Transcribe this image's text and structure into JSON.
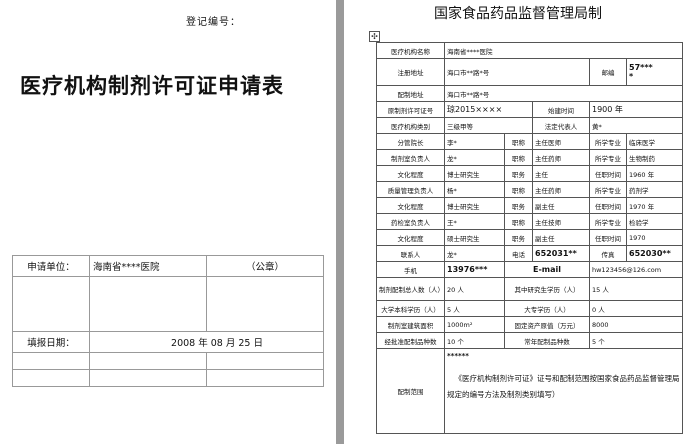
{
  "left": {
    "registration": "登记编号：",
    "title": "医疗机构制剂许可证申请表",
    "applicant_label": "申请单位：",
    "applicant_value": "海南省****医院",
    "seal": "（公章）",
    "date_label": "填报日期：",
    "date_value": "2008 年 08 月  25 日"
  },
  "right": {
    "title": "国家食品药品监督管理局制",
    "handle": "✣",
    "org_name_label": "医疗机构名称",
    "org_name": "海南省****医院",
    "reg_addr_label": "注册地址",
    "reg_addr": "海口市**路*号",
    "zip_label": "邮编",
    "zip": "57***",
    "zip2": "*",
    "prep_addr_label": "配制地址",
    "prep_addr": "海口市**路*号",
    "orig_no_label": "原制剂许可证号",
    "orig_no": "琼2015××××",
    "est_label": "始建时间",
    "est": "1900 年",
    "category_label": "医疗机构类别",
    "category": "三级甲等",
    "legal_label": "法定代表人",
    "legal": "黄*",
    "r1": [
      "分管院长",
      "李*",
      "职称",
      "主任医师",
      "所学专业",
      "临床医学"
    ],
    "r2": [
      "制剂室负责人",
      "龙*",
      "职称",
      "主任药师",
      "所学专业",
      "生物制药"
    ],
    "r3": [
      "文化程度",
      "博士研究生",
      "职务",
      "主任",
      "任职时间",
      "1960 年"
    ],
    "r4": [
      "质量管理负责人",
      "杨*",
      "职称",
      "主任药师",
      "所学专业",
      "药剂学"
    ],
    "r5": [
      "文化程度",
      "博士研究生",
      "职务",
      "副主任",
      "任职时间",
      "1970 年"
    ],
    "r6": [
      "药检室负责人",
      "王*",
      "职称",
      "主任技师",
      "所学专业",
      "检验学"
    ],
    "r7": [
      "文化程度",
      "硕士研究生",
      "职务",
      "副主任",
      "任职时间",
      "1970"
    ],
    "r8": [
      "联系人",
      "龙*",
      "电话",
      "652031**",
      "传真",
      "652030**"
    ],
    "phone_label": "手机",
    "phone": "13976***",
    "email_label": "E-mail",
    "email": "hw123456@126.com",
    "r10": [
      "制剂配制总人数（人）",
      "20 人",
      "其中研究生学历（人）",
      "15 人"
    ],
    "r11": [
      "大学本科学历（人）",
      "5 人",
      "大专学历（人）",
      "0 人"
    ],
    "r12": [
      "制剂室建筑面积",
      "1000m²",
      "固定资产原值（万元）",
      "8000"
    ],
    "r13": [
      "经批准配制品种数",
      "10 个",
      "常年配制品种数",
      "5 个"
    ],
    "scope_label": "配制范围",
    "scope_head": "******",
    "scope_body": "《医疗机构制剂许可证》证号和配制范围按国家食品药品监督管理局规定的编号方法及制剂类别填写）"
  }
}
